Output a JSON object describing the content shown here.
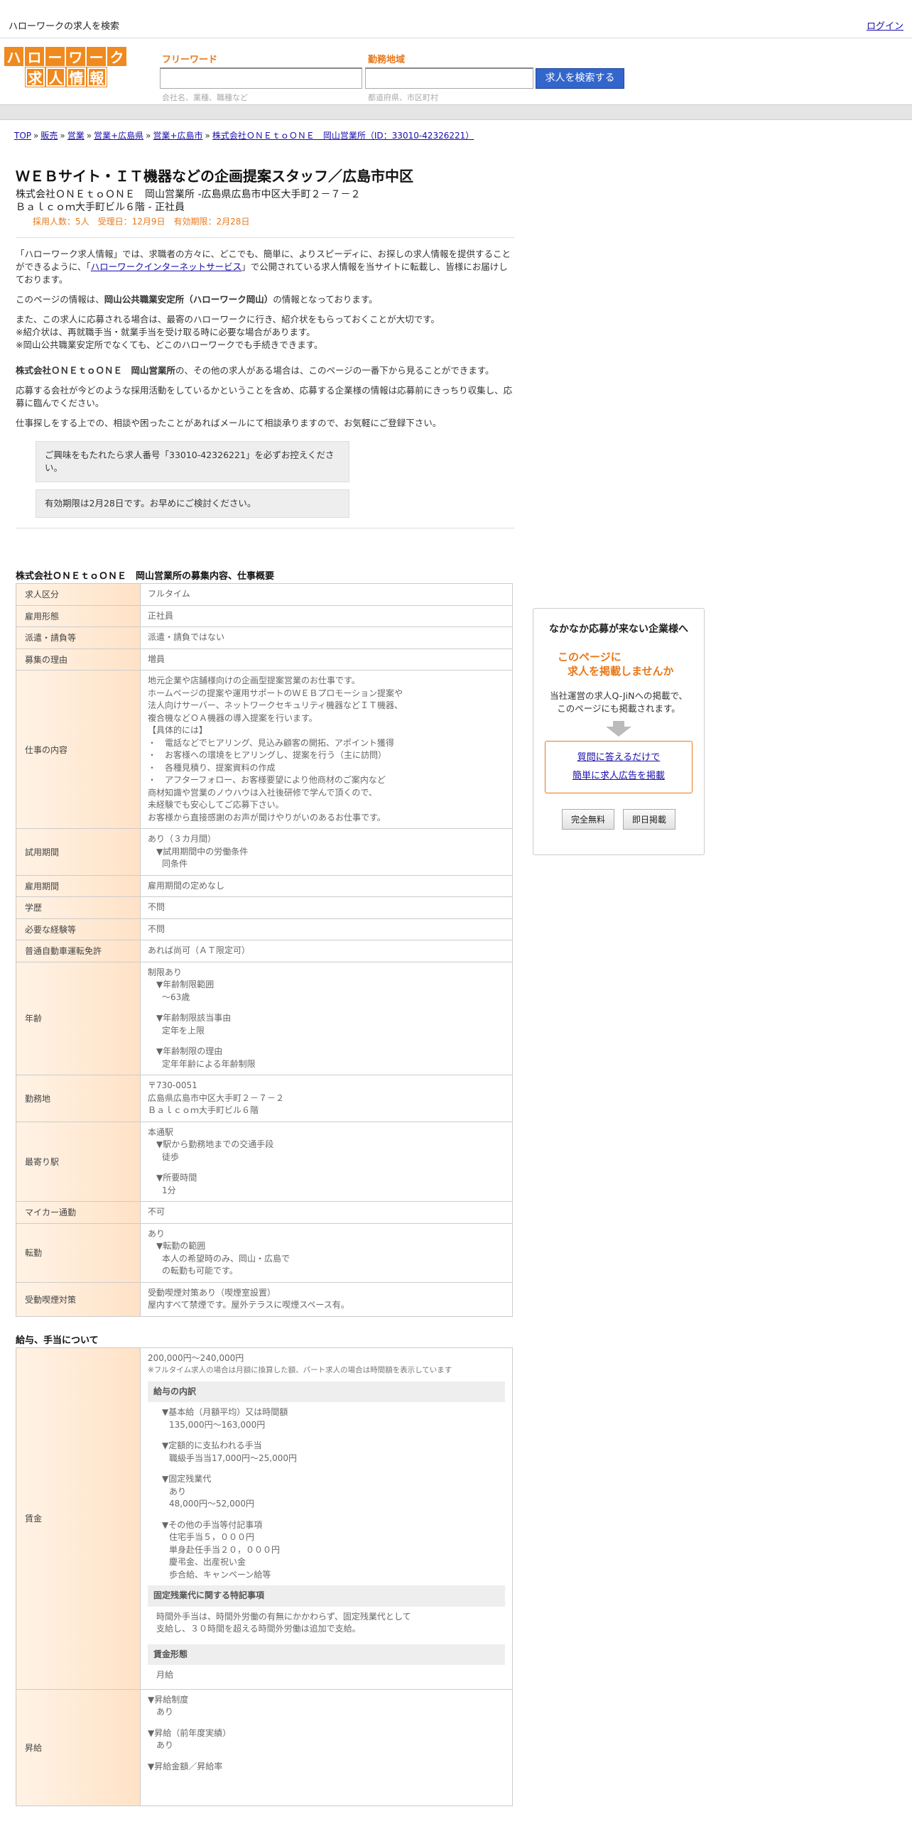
{
  "topbar": {
    "title": "ハローワークの求人を検索",
    "login": "ログイン"
  },
  "logo": {
    "row1": [
      "ハ",
      "ロ",
      "ー",
      "ワ",
      "ー",
      "ク"
    ],
    "row2": [
      "求",
      "人",
      "情",
      "報"
    ]
  },
  "search": {
    "freeword_label": "フリーワード",
    "freeword_hint": "会社名、業種、職種など",
    "area_label": "勤務地域",
    "area_hint": "都道府県、市区町村",
    "button": "求人を検索する"
  },
  "breadcrumb": [
    "TOP",
    "販売",
    "営業",
    "営業+広島県",
    "営業+広島市",
    "株式会社ＯＮＥｔｏＯＮＥ　岡山営業所（ID：33010-42326221）"
  ],
  "job": {
    "title": "ＷＥＢサイト・ＩＴ機器などの企画提案スタッフ／広島市中区",
    "company_line1": "株式会社ＯＮＥｔｏＯＮＥ　岡山営業所 -広島県広島市中区大手町２－７－２",
    "company_line2": "Ｂａｌｃｏｍ大手町ビル６階 - 正社員",
    "meta": "採用人数：5人　受理日：12月9日　有効期限：2月28日"
  },
  "intro": {
    "p1a": "「ハローワーク求人情報」では、求職者の方々に、どこでも、簡単に、よりスピーディに、お探しの求人情報を提供することができるように、「",
    "p1link": "ハローワークインターネットサービス",
    "p1b": "」で公開されている求人情報を当サイトに転載し、皆様にお届けしております。",
    "p2a": "このページの情報は、",
    "p2b": "岡山公共職業安定所（ハローワーク岡山）",
    "p2c": "の情報となっております。",
    "p3": [
      "また、この求人に応募される場合は、最寄のハローワークに行き、紹介状をもらっておくことが大切です。",
      "※紹介状は、再就職手当・就業手当を受け取る時に必要な場合があります。",
      "※岡山公共職業安定所でなくても、どこのハローワークでも手続きできます。"
    ],
    "p4a": "株式会社ＯＮＥｔｏＯＮＥ　岡山営業所",
    "p4b": "の、その他の求人がある場合は、このページの一番下から見ることができます。",
    "p5": "応募する会社が今どのような採用活動をしているかということを含め、応募する企業様の情報は応募前にきっちり収集し、応募に臨んでください。",
    "p6": "仕事探しをする上での、相談や困ったことがあればメールにて相談承りますので、お気軽にご登録下さい。",
    "notice1": "ご興味をもたれたら求人番号「33010-42326221」を必ずお控えください。",
    "notice2": "有効期限は2月28日です。お早めにご検討ください。"
  },
  "section1": {
    "title": "株式会社ＯＮＥｔｏＯＮＥ　岡山営業所の募集内容、仕事概要",
    "rows": {
      "kubun": {
        "label": "求人区分",
        "value": "フルタイム"
      },
      "koyou": {
        "label": "雇用形態",
        "value": "正社員"
      },
      "haken": {
        "label": "派遣・請負等",
        "value": "派遣・請負ではない"
      },
      "riyu": {
        "label": "募集の理由",
        "value": "増員"
      },
      "shigoto": {
        "label": "仕事の内容",
        "lines": [
          "地元企業や店舗様向けの企画型提案営業のお仕事です。",
          "ホームページの提案や運用サポートのＷＥＢプロモーション提案や",
          "法人向けサーバー、ネットワークセキュリティ機器などＩＴ機器、",
          "複合機などＯＡ機器の導入提案を行います。",
          "【具体的には】",
          "・　電話などでヒアリング、見込み顧客の開拓、アポイント獲得",
          "・　お客様への環境をヒアリングし、提案を行う（主に訪問）",
          "・　各種見積り、提案資料の作成",
          "・　アフターフォロー、お客様要望により他商材のご案内など",
          "商材知識や営業のノウハウは入社後研修で学んで頂くので、",
          "未経験でも安心してご応募下さい。",
          "お客様から直接感謝のお声が聞けやりがいのあるお仕事です。"
        ]
      },
      "shiyou": {
        "label": "試用期間",
        "v1": "あり（３カ月間）",
        "v2": "▼試用期間中の労働条件",
        "v3": "同条件"
      },
      "kikan": {
        "label": "雇用期間",
        "value": "雇用期間の定めなし"
      },
      "gakureki": {
        "label": "学歴",
        "value": "不問"
      },
      "keiken": {
        "label": "必要な経験等",
        "value": "不問"
      },
      "menkyo": {
        "label": "普通自動車運転免許",
        "value": "あれば尚可（ＡＴ限定可）"
      },
      "nenrei": {
        "label": "年齢",
        "v1": "制限あり",
        "v2": "▼年齢制限範囲",
        "v3": "〜63歳",
        "v4": "▼年齢制限該当事由",
        "v5": "定年を上限",
        "v6": "▼年齢制限の理由",
        "v7": "定年年齢による年齢制限"
      },
      "kinmuchi": {
        "label": "勤務地",
        "v1": "〒730-0051",
        "v2": "広島県広島市中区大手町２－７－２",
        "v3": "Ｂａｌｃｏｍ大手町ビル６階"
      },
      "eki": {
        "label": "最寄り駅",
        "v1": "本通駅",
        "v2": "▼駅から勤務地までの交通手段",
        "v3": "徒歩",
        "v4": "▼所要時間",
        "v5": "1分"
      },
      "mycar": {
        "label": "マイカー通勤",
        "value": "不可"
      },
      "tenkin": {
        "label": "転勤",
        "v1": "あり",
        "v2": "▼転勤の範囲",
        "v3": "本人の希望時のみ、岡山・広島で",
        "v4": "の転勤も可能です。"
      },
      "kitsuen": {
        "label": "受動喫煙対策",
        "v1": "受動喫煙対策あり（喫煙室設置）",
        "v2": "屋内すべて禁煙です。屋外テラスに喫煙スペース有。"
      }
    }
  },
  "section2": {
    "title": "給与、手当について",
    "chingin": {
      "label": "賃金",
      "range": "200,000円〜240,000円",
      "note": "※フルタイム求人の場合は月額に換算した額、パート求人の場合は時間額を表示しています",
      "breakdown_title": "給与の内訳",
      "kihon_h": "▼基本給（月額平均）又は時間額",
      "kihon_v": "135,000円〜163,000円",
      "teigaku_h": "▼定額的に支払われる手当",
      "teigaku_v": "職級手当当17,000円〜25,000円",
      "kotei_h": "▼固定残業代",
      "kotei_v1": "あり",
      "kotei_v2": "48,000円〜52,000円",
      "sonota_h": "▼その他の手当等付記事項",
      "sonota_v": [
        "住宅手当５，０００円",
        "単身赴任手当２０，０００円",
        "慶弔金、出産祝い金",
        "歩合給、キャンペーン給等"
      ],
      "tokki_title": "固定残業代に関する特記事項",
      "tokki_v1": "時間外手当は、時間外労働の有無にかかわらず、固定残業代として",
      "tokki_v2": "支給し、３０時間を超える時間外労働は追加で支給。",
      "keitai_title": "賃金形態",
      "keitai_v": "月給"
    },
    "shokyu": {
      "label": "昇給",
      "v1": "▼昇給制度",
      "v2": "あり",
      "v3": "▼昇給（前年度実績）",
      "v4": "あり",
      "v5": "▼昇給金額／昇給率"
    }
  },
  "sidead": {
    "heading": "なかなか応募が来ない企業様へ",
    "orange1": "このページに",
    "orange2": "求人を掲載しませんか",
    "desc1": "当社運営の求人Q-JiNへの掲載で、",
    "desc2": "このページにも掲載されます。",
    "link1": "質問に答えるだけで",
    "link2": "簡単に求人広告を掲載",
    "btn1": "完全無料",
    "btn2": "即日掲載"
  }
}
